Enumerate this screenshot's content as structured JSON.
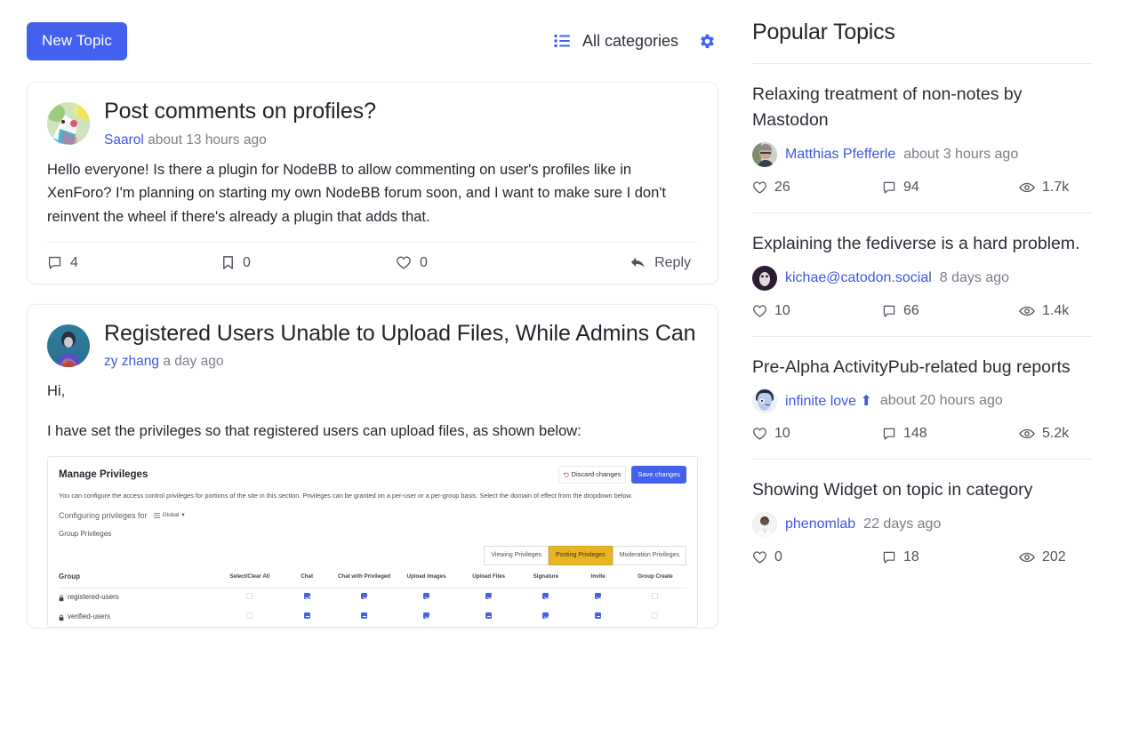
{
  "toolbar": {
    "new_topic_label": "New Topic",
    "category_label": "All categories",
    "list_icon": "list-icon",
    "gear_icon": "gear-icon",
    "accent_color": "#4361ee"
  },
  "posts": [
    {
      "title": "Post comments on profiles?",
      "author": "Saarol",
      "timestamp": "about 13 hours ago",
      "body": [
        "Hello everyone! Is there a plugin for NodeBB to allow commenting on user's profiles like in XenForo? I'm planning on starting my own NodeBB forum soon, and I want to make sure I don't reinvent the wheel if there's already a plugin that adds that."
      ],
      "actions": {
        "replies": "4",
        "bookmarks": "0",
        "likes": "0",
        "reply_label": "Reply"
      }
    },
    {
      "title": "Registered Users Unable to Upload Files, While Admins Can",
      "author": "zy zhang",
      "timestamp": "a day ago",
      "body": [
        "Hi,",
        "I have set the privileges so that registered users can upload files, as shown below:"
      ]
    }
  ],
  "embedded_screenshot": {
    "title": "Manage Privileges",
    "discard_label": "Discard changes",
    "save_label": "Save changes",
    "description": "You can configure the access control privileges for portions of the site in this section. Privileges can be granted on a per-user or a per-group basis. Select the domain of effect from the dropdown below.",
    "configuring_label": "Configuring privileges for",
    "scope_value": "Global",
    "section_label": "Group Privileges",
    "tabs": [
      {
        "label": "Viewing Privileges",
        "active": false
      },
      {
        "label": "Posting Privileges",
        "active": true
      },
      {
        "label": "Moderation Privileges",
        "active": false
      }
    ],
    "columns": [
      "Group",
      "Select/Clear All",
      "Chat",
      "Chat with Privileged",
      "Upload Images",
      "Upload Files",
      "Signature",
      "Invite",
      "Group Create"
    ],
    "rows": [
      {
        "group": "registered-users",
        "select_all": "off",
        "cells": [
          "on",
          "on",
          "on",
          "on",
          "on",
          "on",
          "off"
        ]
      },
      {
        "group": "verified-users",
        "select_all": "off",
        "cells": [
          "dash",
          "dash",
          "on",
          "dash",
          "on",
          "dash",
          "off"
        ]
      }
    ],
    "active_tab_color": "#e8b423",
    "save_color": "#4361ee"
  },
  "sidebar": {
    "title": "Popular Topics",
    "topics": [
      {
        "title": "Relaxing treatment of non-notes by Mastodon",
        "author": "Matthias Pfefferle",
        "timestamp": "about 3 hours ago",
        "likes": "26",
        "replies": "94",
        "views": "1.7k"
      },
      {
        "title": "Explaining the fediverse is a hard problem.",
        "author": "kichae@catodon.social",
        "timestamp": "8 days ago",
        "likes": "10",
        "replies": "66",
        "views": "1.4k"
      },
      {
        "title": "Pre-Alpha ActivityPub-related bug reports",
        "author": "infinite love ⬆",
        "timestamp": "about 20 hours ago",
        "likes": "10",
        "replies": "148",
        "views": "5.2k"
      },
      {
        "title": "Showing Widget on topic in category",
        "author": "phenomlab",
        "timestamp": "22 days ago",
        "likes": "0",
        "replies": "18",
        "views": "202"
      }
    ]
  }
}
